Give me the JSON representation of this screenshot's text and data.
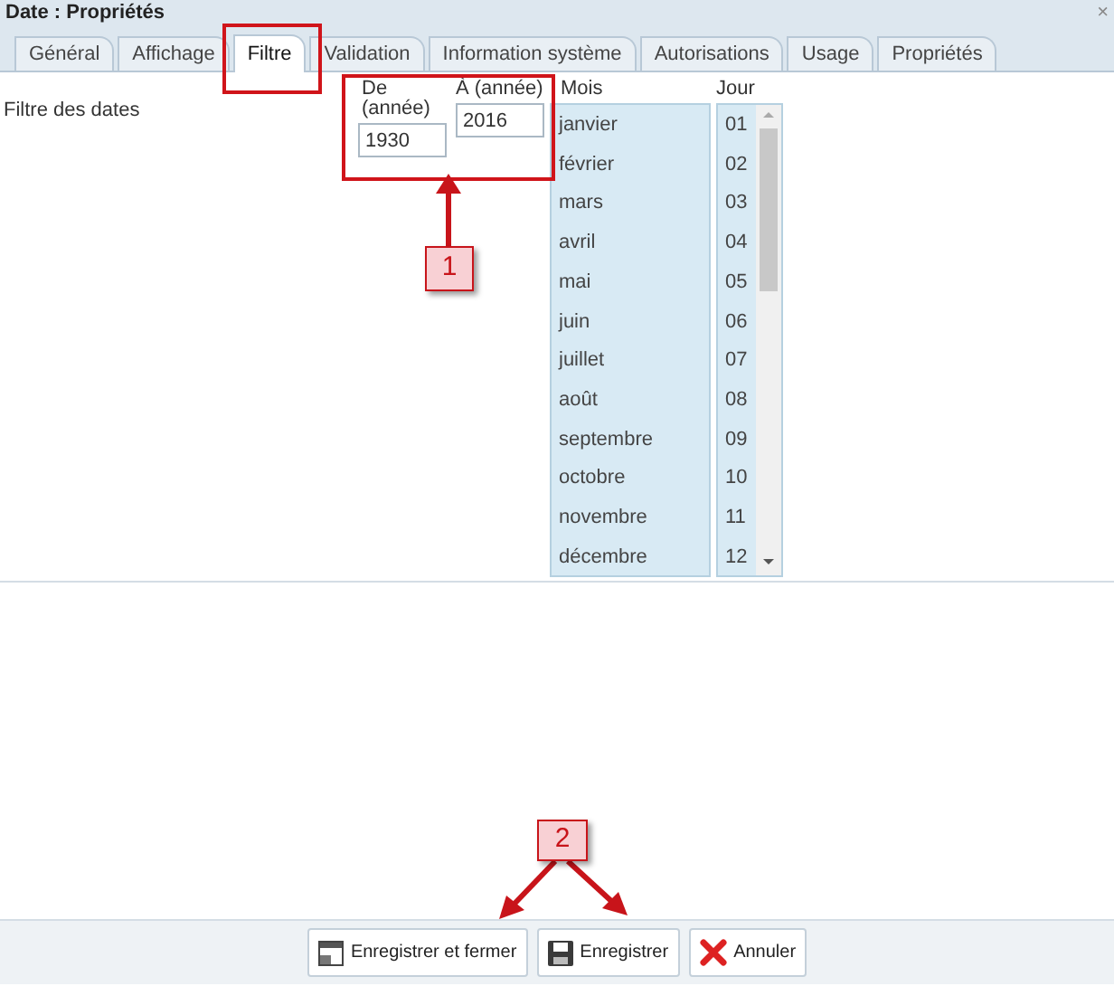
{
  "window": {
    "title": "Date : Propriétés",
    "close": "×"
  },
  "tabs": [
    {
      "label": "Général",
      "selected": false
    },
    {
      "label": "Affichage",
      "selected": false
    },
    {
      "label": "Filtre",
      "selected": true
    },
    {
      "label": "Validation",
      "selected": false
    },
    {
      "label": "Information système",
      "selected": false
    },
    {
      "label": "Autorisations",
      "selected": false
    },
    {
      "label": "Usage",
      "selected": false
    },
    {
      "label": "Propriétés",
      "selected": false
    }
  ],
  "section_label": "Filtre des dates",
  "year_fields": [
    {
      "label": "De (année)",
      "value": "1930"
    },
    {
      "label": "À (année)",
      "value": "2016"
    }
  ],
  "months": {
    "label": "Mois",
    "items": [
      "janvier",
      "février",
      "mars",
      "avril",
      "mai",
      "juin",
      "juillet",
      "août",
      "septembre",
      "octobre",
      "novembre",
      "décembre"
    ]
  },
  "days": {
    "label": "Jour",
    "items": [
      "01",
      "02",
      "03",
      "04",
      "05",
      "06",
      "07",
      "08",
      "09",
      "10",
      "11",
      "12"
    ]
  },
  "buttons": [
    {
      "label": "Enregistrer et fermer",
      "kind": "save-close"
    },
    {
      "label": "Enregistrer",
      "kind": "save"
    },
    {
      "label": "Annuler",
      "kind": "cancel"
    }
  ],
  "callouts": [
    "1",
    "2"
  ]
}
